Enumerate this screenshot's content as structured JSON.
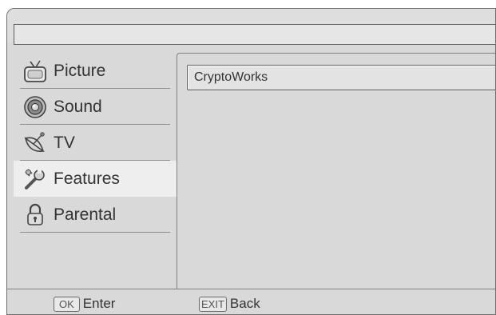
{
  "header": {
    "title": ""
  },
  "sidebar": {
    "items": [
      {
        "label": "Picture",
        "icon": "tv-icon"
      },
      {
        "label": "Sound",
        "icon": "speaker-icon"
      },
      {
        "label": "TV",
        "icon": "satellite-dish-icon"
      },
      {
        "label": "Features",
        "icon": "wrench-icon",
        "active": true
      },
      {
        "label": "Parental",
        "icon": "padlock-icon"
      }
    ]
  },
  "panel": {
    "items": [
      {
        "label": "CryptoWorks"
      }
    ]
  },
  "footer": {
    "hints": [
      {
        "key": "OK",
        "label": "Enter"
      },
      {
        "key": "EXIT",
        "label": "Back"
      }
    ]
  },
  "colors": {
    "background": "#d9d9d9",
    "active_item": "#eeeeee",
    "text": "#333333",
    "border": "#6f6f6f"
  }
}
